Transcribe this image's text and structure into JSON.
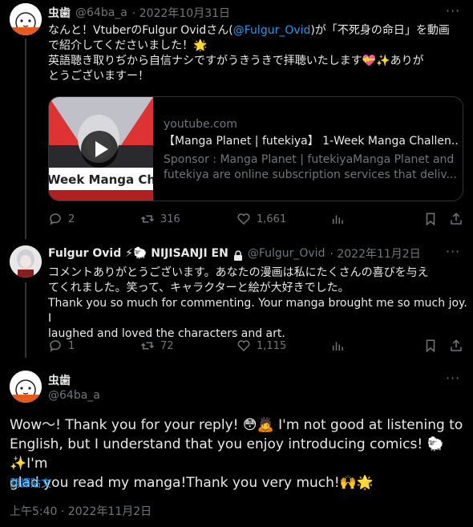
{
  "tweet1": {
    "name": "虫歯",
    "handle": "@64ba_a",
    "date": "· 2022年10月31日",
    "text_prefix": "なんと！VtuberのFulgur Ovidさん(",
    "mention": "@Fulgur_Ovid",
    "text_mid": ")が「不死身の命日」を動画",
    "text_line2": "で紹介してくださいました！🌟",
    "text_line3": "英語聴き取りぢから自信ナシですがうきうきで拝聴いたします💝✨ありが",
    "text_line4": "とうございますー！",
    "card": {
      "thumb_text": "Week Manga Challe",
      "domain": "youtube.com",
      "title": "【Manga Planet | futekiya】 1-Week Manga Challen...",
      "desc_line1": "Sponsor : Manga Planet | futekiyaManga Planet and",
      "desc_line2": "futekiya are online subscription services that deliv..."
    },
    "replies": "2",
    "retweets": "316",
    "likes": "1,661"
  },
  "tweet2": {
    "name": "Fulgur Ovid ⚡🐑 NIJISANJI EN",
    "handle": "@Fulgur_Ovid",
    "date": "· 2022年11月2日",
    "line1": "コメントありがとうございます。あなたの漫画は私にたくさんの喜びを与え",
    "line2": "てくれました。笑って、キャラクターと絵が大好きでした。",
    "line3": "Thank you so much for commenting. Your manga brought me so much joy. I",
    "line4": "laughed and loved the characters and art.",
    "replies": "1",
    "retweets": "72",
    "likes": "1,115"
  },
  "tweet3": {
    "name": "虫歯",
    "handle": "@64ba_a",
    "line1": "Wow〜! Thank you for your reply! 😳🙇 I'm not good at listening to",
    "line2": "English, but I understand that you enjoy introducing comics! 🐑✨I'm",
    "line3": "glad you read my manga!Thank you very much!🙌🌟",
    "translate": "翻譯貼文",
    "timestamp": "上午5:40 · 2022年11月2日"
  },
  "colors": {
    "background": "#000000",
    "text": "#e7e9ea",
    "muted": "#71767b",
    "link": "#1d9bf0",
    "border": "#2f3336"
  }
}
